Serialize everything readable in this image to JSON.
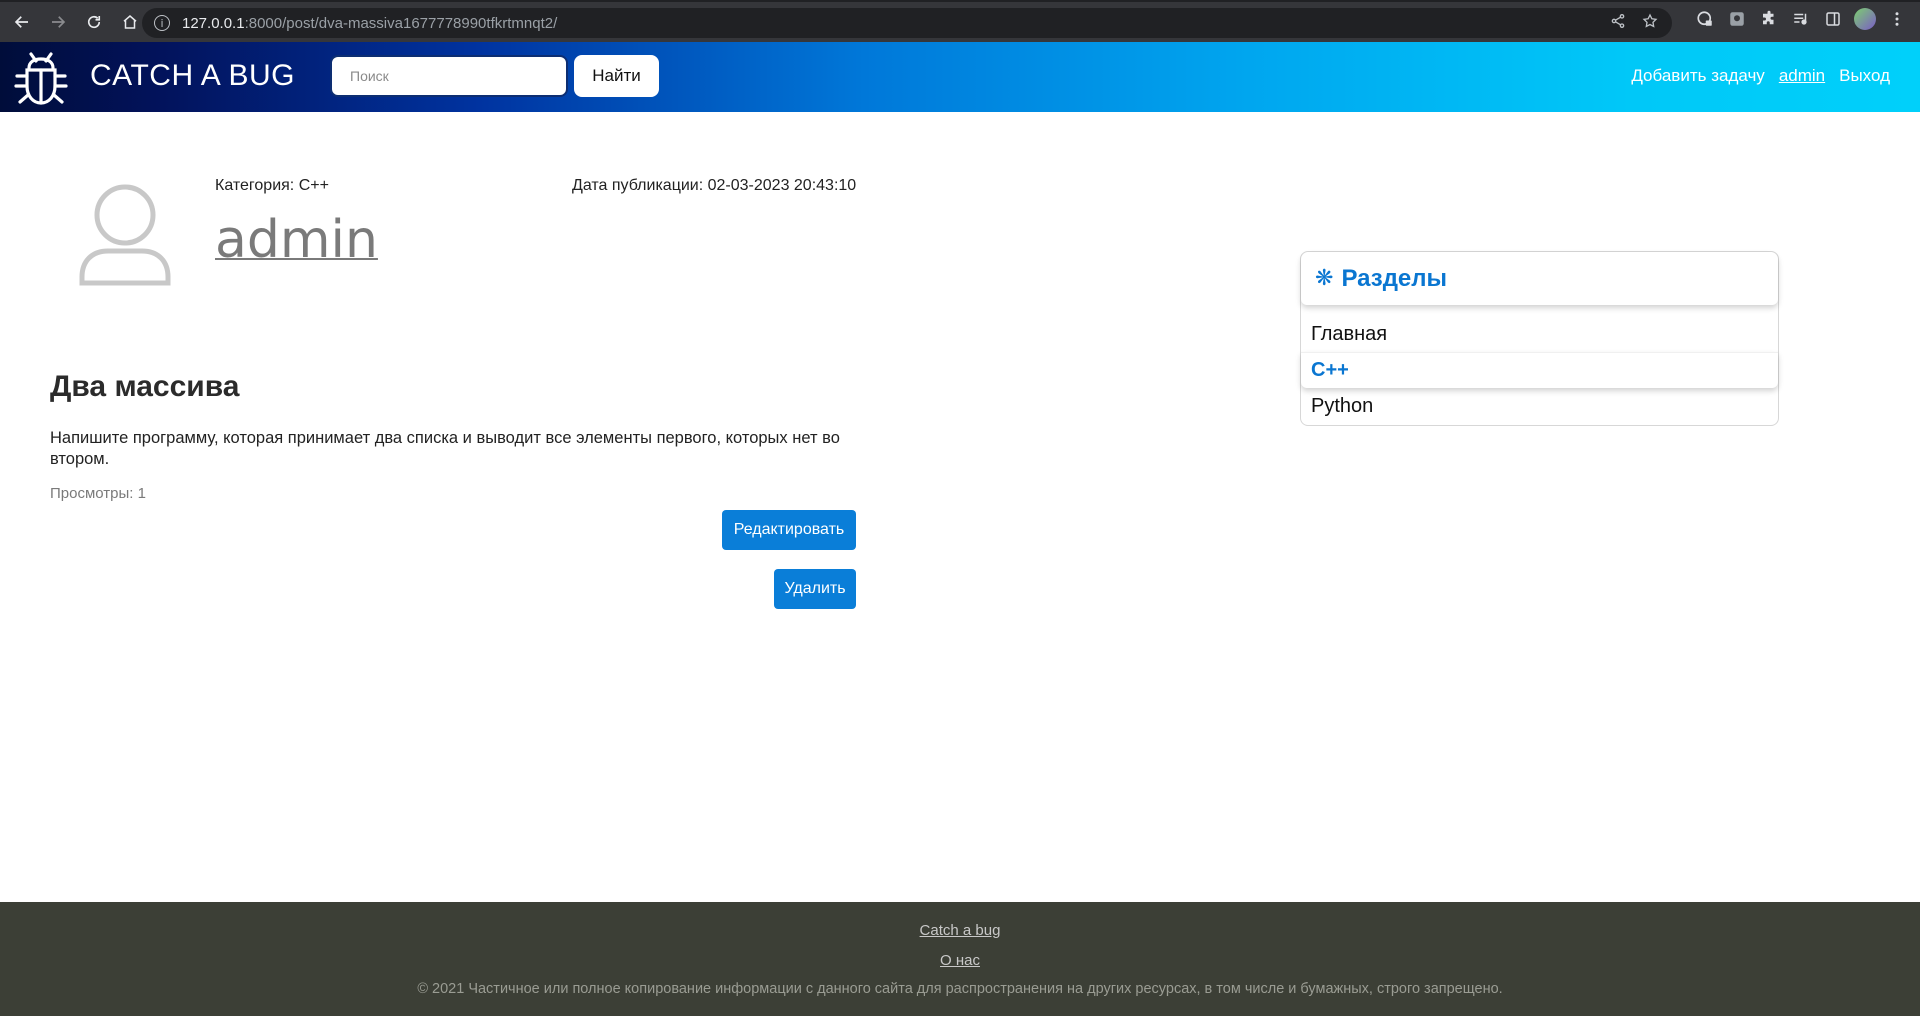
{
  "browser": {
    "url_host": "127.0.0.1",
    "url_rest": ":8000/post/dva-massiva1677778990tfkrtmnqt2/"
  },
  "header": {
    "brand": "CATCH A BUG",
    "search_placeholder": "Поиск",
    "search_button": "Найти",
    "links": {
      "add_task": "Добавить задачу",
      "user": "admin",
      "logout": "Выход"
    }
  },
  "post": {
    "category": "Категория: C++",
    "date": "Дата публикации: 02-03-2023 20:43:10",
    "author": "admin",
    "title": "Два массива",
    "body": "Напишите программу, которая принимает два списка и выводит все элементы первого, которых нет во втором.",
    "views": "Просмотры: 1",
    "edit_label": "Редактировать",
    "delete_label": "Удалить"
  },
  "sidebar": {
    "title": "Разделы",
    "items": [
      {
        "label": "Главная",
        "active": false
      },
      {
        "label": "C++",
        "active": true
      },
      {
        "label": "Python",
        "active": false
      }
    ]
  },
  "footer": {
    "link1": "Catch a bug",
    "link2": "О нас",
    "copyright": "© 2021 Частичное или полное копирование информации с данного сайта для распространения на других ресурсах, в том числе и бумажных, строго запрещено."
  },
  "colors": {
    "accent": "#0a7ed8",
    "footer_bg": "#3c3f36"
  }
}
